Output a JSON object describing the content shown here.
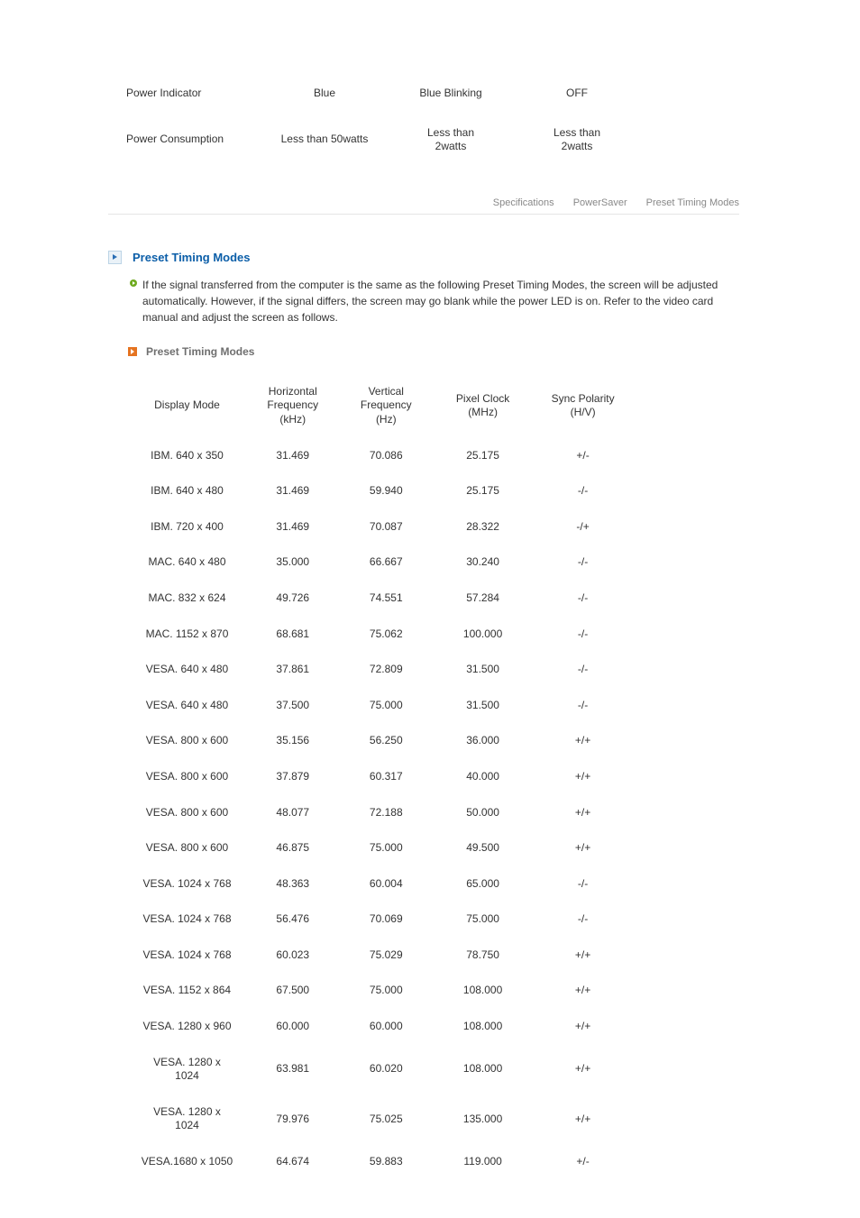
{
  "power_table": {
    "rows": [
      {
        "label": "Power Indicator",
        "c1": "Blue",
        "c2": "Blue Blinking",
        "c3": "OFF"
      },
      {
        "label": "Power Consumption",
        "c1": "Less than 50watts",
        "c2": "Less than\n2watts",
        "c3": "Less than\n2watts"
      }
    ]
  },
  "links": {
    "items": [
      "Specifications",
      "PowerSaver",
      "Preset Timing Modes"
    ]
  },
  "section": {
    "title": "Preset Timing Modes",
    "body": "If the signal transferred from the computer is the same as the following Preset Timing Modes, the screen will be adjusted automatically. However, if the signal differs, the screen may go blank while the power LED is on. Refer to the video card manual and adjust the screen as follows.",
    "sub_title": "Preset Timing Modes"
  },
  "timing_headers": {
    "display_mode": "Display Mode",
    "hfreq": "Horizontal\nFrequency\n(kHz)",
    "vfreq": "Vertical\nFrequency\n(Hz)",
    "pclk": "Pixel Clock\n(MHz)",
    "sync": "Sync Polarity\n(H/V)"
  },
  "chart_data": {
    "type": "table",
    "title": "Preset Timing Modes",
    "columns": [
      "Display Mode",
      "Horizontal Frequency (kHz)",
      "Vertical Frequency (Hz)",
      "Pixel Clock (MHz)",
      "Sync Polarity (H/V)"
    ],
    "rows": [
      {
        "mode": "IBM. 640 x 350",
        "hfreq": "31.469",
        "vfreq": "70.086",
        "pclk": "25.175",
        "sync": "+/-"
      },
      {
        "mode": "IBM. 640 x 480",
        "hfreq": "31.469",
        "vfreq": "59.940",
        "pclk": "25.175",
        "sync": "-/-"
      },
      {
        "mode": "IBM. 720 x 400",
        "hfreq": "31.469",
        "vfreq": "70.087",
        "pclk": "28.322",
        "sync": "-/+"
      },
      {
        "mode": "MAC. 640 x 480",
        "hfreq": "35.000",
        "vfreq": "66.667",
        "pclk": "30.240",
        "sync": "-/-"
      },
      {
        "mode": "MAC. 832 x 624",
        "hfreq": "49.726",
        "vfreq": "74.551",
        "pclk": "57.284",
        "sync": "-/-"
      },
      {
        "mode": "MAC. 1152 x 870",
        "hfreq": "68.681",
        "vfreq": "75.062",
        "pclk": "100.000",
        "sync": "-/-"
      },
      {
        "mode": "VESA. 640 x 480",
        "hfreq": "37.861",
        "vfreq": "72.809",
        "pclk": "31.500",
        "sync": "-/-"
      },
      {
        "mode": "VESA. 640 x 480",
        "hfreq": "37.500",
        "vfreq": "75.000",
        "pclk": "31.500",
        "sync": "-/-"
      },
      {
        "mode": "VESA. 800 x 600",
        "hfreq": "35.156",
        "vfreq": "56.250",
        "pclk": "36.000",
        "sync": "+/+"
      },
      {
        "mode": "VESA. 800 x 600",
        "hfreq": "37.879",
        "vfreq": "60.317",
        "pclk": "40.000",
        "sync": "+/+"
      },
      {
        "mode": "VESA. 800 x 600",
        "hfreq": "48.077",
        "vfreq": "72.188",
        "pclk": "50.000",
        "sync": "+/+"
      },
      {
        "mode": "VESA. 800 x 600",
        "hfreq": "46.875",
        "vfreq": "75.000",
        "pclk": "49.500",
        "sync": "+/+"
      },
      {
        "mode": "VESA. 1024 x 768",
        "hfreq": "48.363",
        "vfreq": "60.004",
        "pclk": "65.000",
        "sync": "-/-"
      },
      {
        "mode": "VESA. 1024 x 768",
        "hfreq": "56.476",
        "vfreq": "70.069",
        "pclk": "75.000",
        "sync": "-/-"
      },
      {
        "mode": "VESA. 1024 x 768",
        "hfreq": "60.023",
        "vfreq": "75.029",
        "pclk": "78.750",
        "sync": "+/+"
      },
      {
        "mode": "VESA. 1152 x 864",
        "hfreq": "67.500",
        "vfreq": "75.000",
        "pclk": "108.000",
        "sync": "+/+"
      },
      {
        "mode": "VESA. 1280 x 960",
        "hfreq": "60.000",
        "vfreq": "60.000",
        "pclk": "108.000",
        "sync": "+/+"
      },
      {
        "mode": "VESA. 1280 x\n1024",
        "hfreq": "63.981",
        "vfreq": "60.020",
        "pclk": "108.000",
        "sync": "+/+"
      },
      {
        "mode": "VESA. 1280 x\n1024",
        "hfreq": "79.976",
        "vfreq": "75.025",
        "pclk": "135.000",
        "sync": "+/+"
      },
      {
        "mode": "VESA.1680 x 1050",
        "hfreq": "64.674",
        "vfreq": "59.883",
        "pclk": "119.000",
        "sync": "+/-"
      }
    ]
  }
}
